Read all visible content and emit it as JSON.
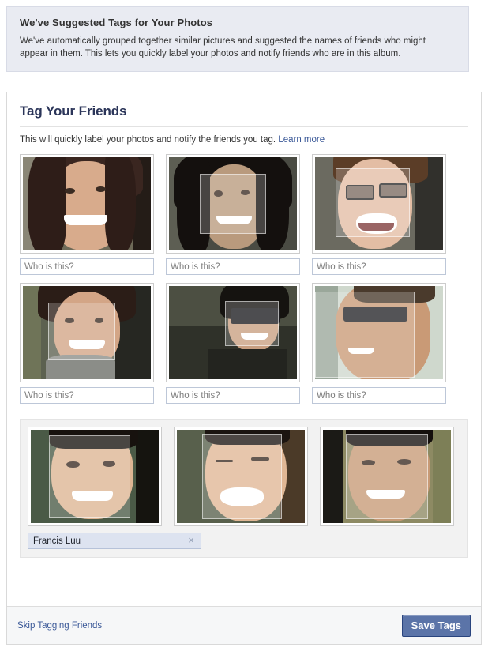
{
  "banner": {
    "title": "We've Suggested Tags for Your Photos",
    "body": "We've automatically grouped together similar pictures and suggested the names of friends who might appear in them. This lets you quickly label your photos and notify friends who are in this album."
  },
  "card": {
    "title": "Tag Your Friends",
    "subtitle": "This will quickly label your photos and notify the friends you tag.",
    "learn_more": "Learn more"
  },
  "rows": [
    {
      "cells": [
        {
          "photo": "woman-freckles-smiling",
          "placeholder": "Who is this?",
          "value": "",
          "facebox": false
        },
        {
          "photo": "woman-dark-hair-smiling",
          "placeholder": "Who is this?",
          "value": "",
          "facebox": true
        },
        {
          "photo": "man-glasses-laughing",
          "placeholder": "Who is this?",
          "value": "",
          "facebox": true
        }
      ]
    },
    {
      "cells": [
        {
          "photo": "woman-earrings-smiling",
          "placeholder": "Who is this?",
          "value": "",
          "facebox": true
        },
        {
          "photo": "person-sunglasses-smiling",
          "placeholder": "Who is this?",
          "value": "",
          "facebox": true
        },
        {
          "photo": "man-sunglasses-profile",
          "placeholder": "Who is this?",
          "value": "",
          "facebox": true
        }
      ]
    }
  ],
  "group": {
    "photos": [
      {
        "photo": "man-smiling-front",
        "facebox": true
      },
      {
        "photo": "man-laughing-eyes-closed",
        "facebox": true
      },
      {
        "photo": "man-grinning-outdoors",
        "facebox": true
      }
    ],
    "name_value": "Francis Luu",
    "name_placeholder": "Who is this?",
    "clear_icon": "×"
  },
  "footer": {
    "skip_label": "Skip Tagging Friends",
    "save_label": "Save Tags"
  },
  "colors": {
    "banner_bg": "#e9ebf2",
    "link": "#3b5998",
    "button_bg": "#5b74a8",
    "button_border": "#29447e",
    "title": "#2b3559",
    "named_field_bg": "#dde3f0",
    "group_bg": "#f2f2f2"
  }
}
